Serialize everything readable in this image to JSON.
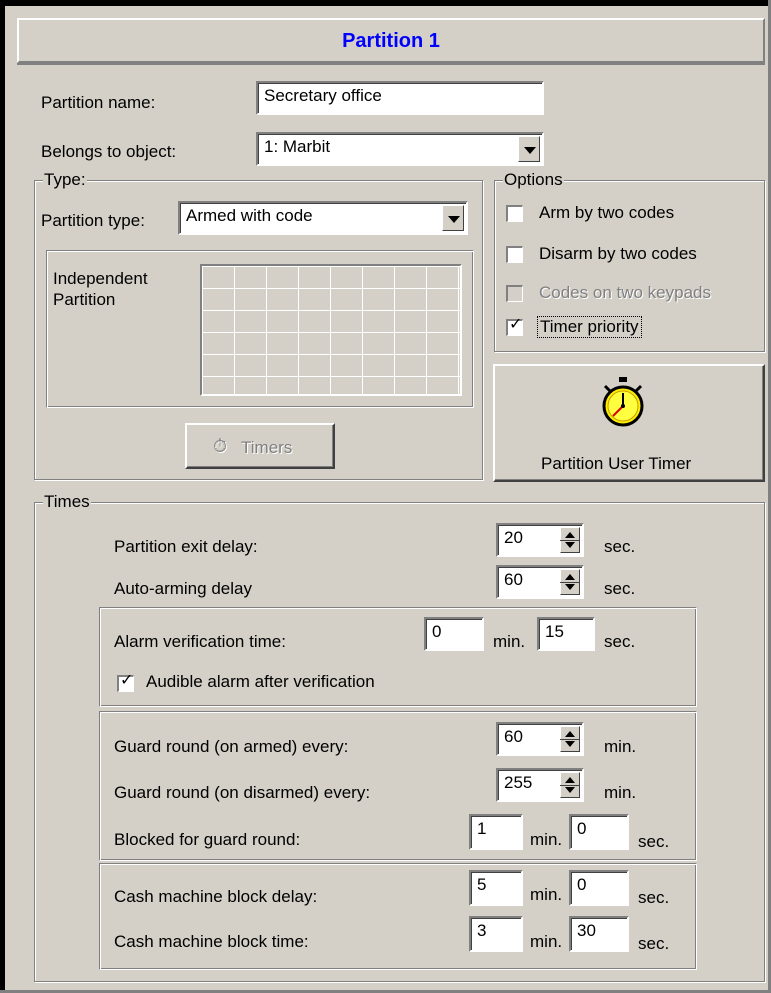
{
  "header": {
    "title": "Partition 1"
  },
  "general": {
    "partition_name_label": "Partition name:",
    "partition_name_value": "Secretary office",
    "belongs_label": "Belongs to object:",
    "belongs_value": "1: Marbit"
  },
  "type": {
    "group_title": "Type:",
    "partition_type_label": "Partition type:",
    "partition_type_value": "Armed with code",
    "independent_label_1": "Independent",
    "independent_label_2": "Partition",
    "timers_button": "Timers"
  },
  "options": {
    "group_title": "Options",
    "items": [
      {
        "label": "Arm by two codes",
        "checked": false,
        "enabled": true
      },
      {
        "label": "Disarm by two codes",
        "checked": false,
        "enabled": true
      },
      {
        "label": "Codes on two keypads",
        "checked": false,
        "enabled": false
      },
      {
        "label": "Timer priority",
        "checked": true,
        "enabled": true
      }
    ],
    "user_timer_button": "Partition User Timer"
  },
  "times": {
    "group_title": "Times",
    "exit_delay_label": "Partition exit delay:",
    "exit_delay_value": "20",
    "auto_arming_label": "Auto-arming delay",
    "auto_arming_value": "60",
    "sec": "sec.",
    "min": "min.",
    "alarm_verification_label": "Alarm verification time:",
    "alarm_verification_min": "0",
    "alarm_verification_sec": "15",
    "audible_alarm_label": "Audible alarm after verification",
    "audible_alarm_checked": true,
    "guard_armed_label": "Guard round (on armed) every:",
    "guard_armed_value": "60",
    "guard_disarmed_label": "Guard round (on disarmed) every:",
    "guard_disarmed_value": "255",
    "blocked_guard_label": "Blocked for guard round:",
    "blocked_guard_min": "1",
    "blocked_guard_sec": "0",
    "cash_delay_label": "Cash machine block delay:",
    "cash_delay_min": "5",
    "cash_delay_sec": "0",
    "cash_time_label": "Cash machine block time:",
    "cash_time_min": "3",
    "cash_time_sec": "30"
  }
}
